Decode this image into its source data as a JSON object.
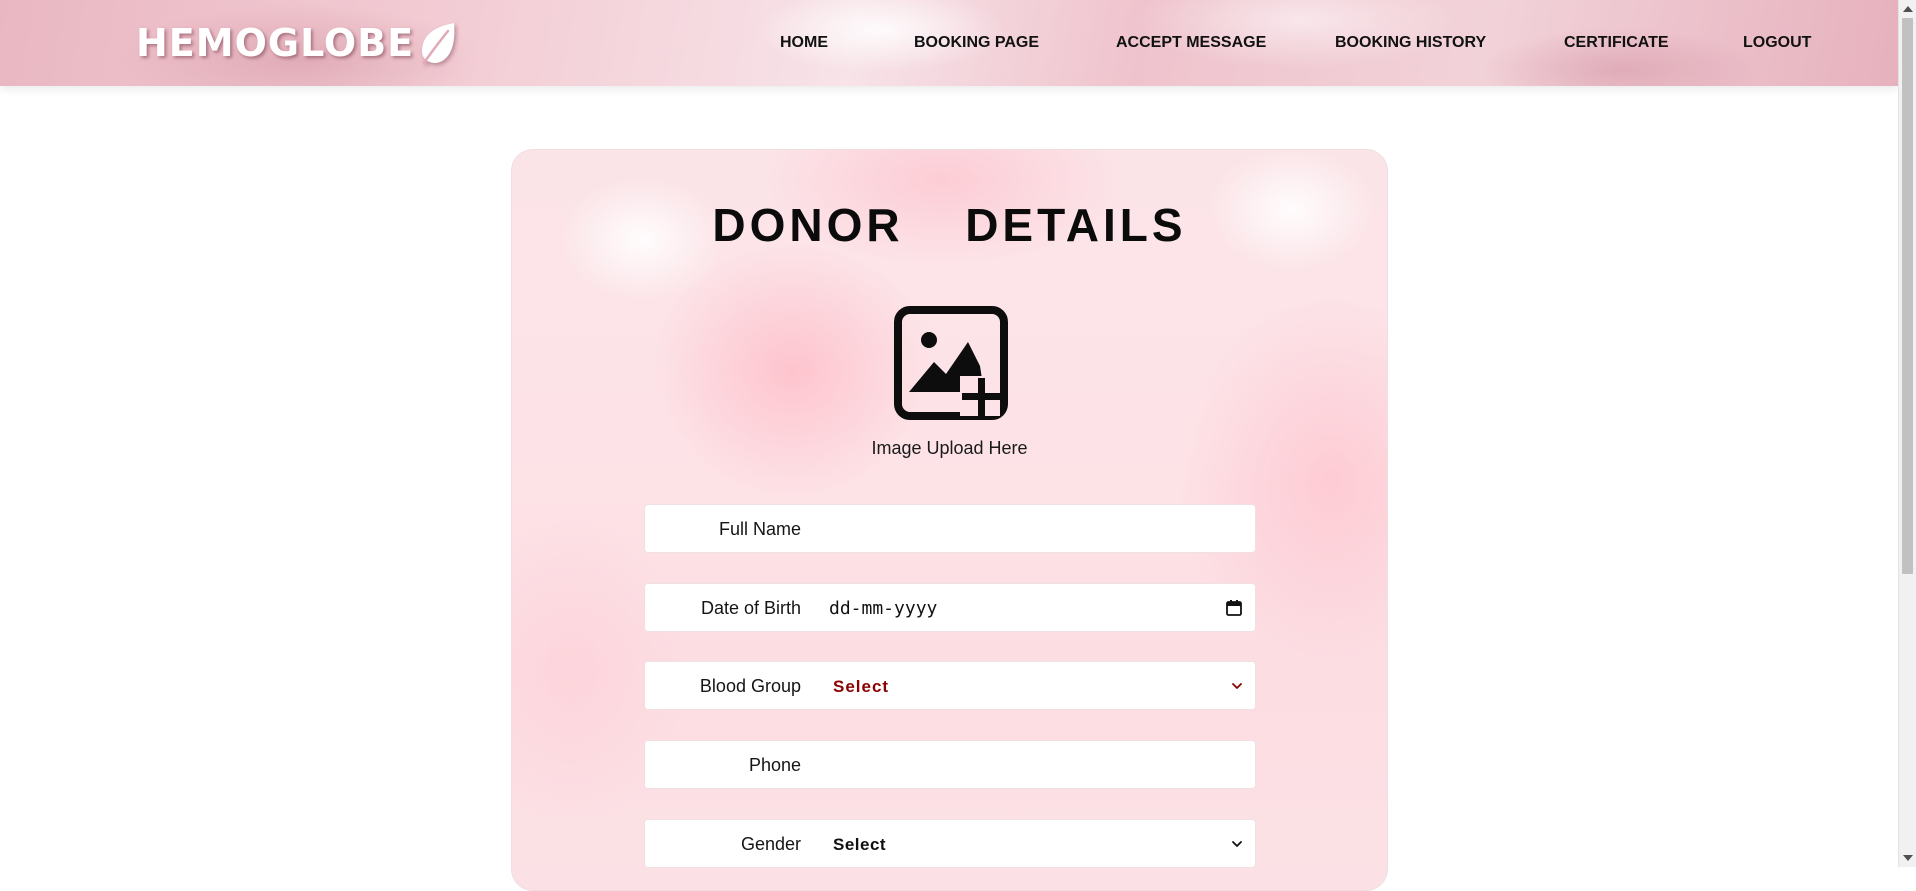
{
  "brand": {
    "name": "HEMOGLOBE",
    "logo_icon": "leaf-icon"
  },
  "nav": {
    "items": [
      {
        "label": "HOME"
      },
      {
        "label": "BOOKING PAGE"
      },
      {
        "label": "ACCEPT MESSAGE"
      },
      {
        "label": "BOOKING HISTORY"
      },
      {
        "label": "CERTIFICATE"
      },
      {
        "label": "LOGOUT"
      }
    ]
  },
  "form": {
    "title": "DONOR  DETAILS",
    "upload": {
      "icon": "image-add-icon",
      "label": "Image Upload Here"
    },
    "fields": {
      "full_name": {
        "label": "Full Name",
        "value": ""
      },
      "dob": {
        "label": "Date of Birth",
        "placeholder": "dd-mm-yyyy",
        "icon": "calendar-icon"
      },
      "blood_group": {
        "label": "Blood Group",
        "value": "Select",
        "color": "#8b0000"
      },
      "phone": {
        "label": "Phone",
        "value": ""
      },
      "gender": {
        "label": "Gender",
        "value": "Select",
        "color": "#111111"
      }
    }
  },
  "colors": {
    "nav_bg": "#efc3cd",
    "card_bg": "#fde3e7",
    "select_accent": "#8b0000"
  }
}
